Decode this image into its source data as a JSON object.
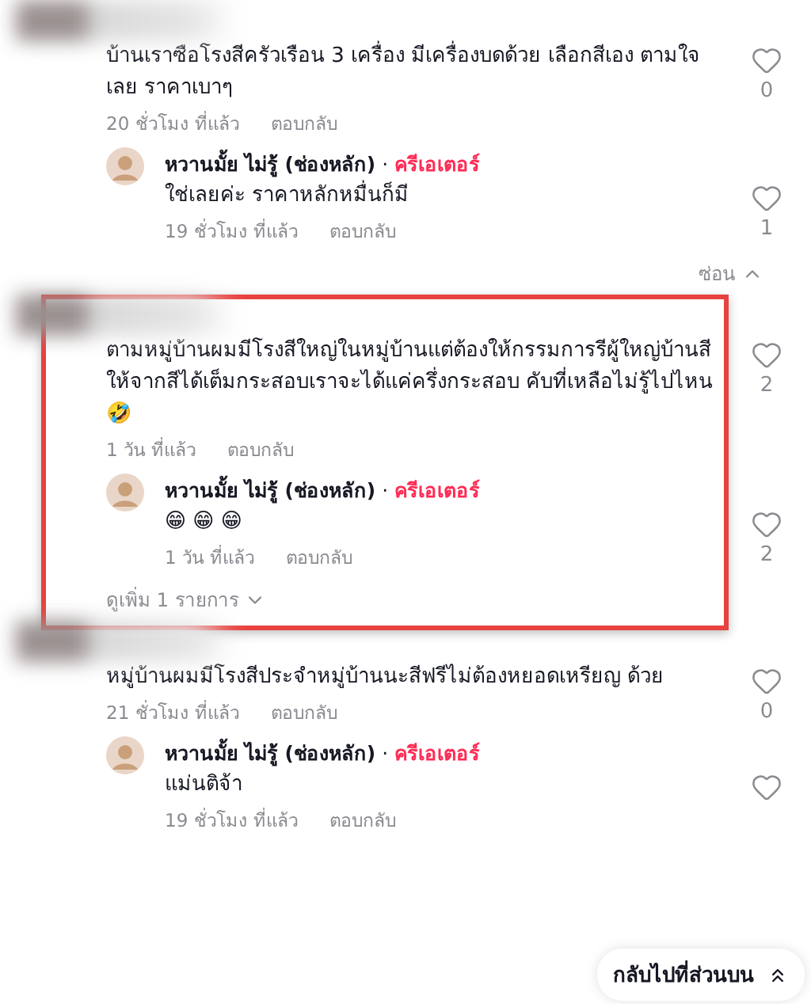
{
  "comments": [
    {
      "text": "บ้านเราซือโรงสีครัวเรือน 3 เครื่อง มีเครื่องบดด้วย เลือกสีเอง ตามใจเลย ราคาเบาๆ",
      "time": "20 ชั่วโมง ที่แล้ว",
      "reply_label": "ตอบกลับ",
      "likes": "0",
      "highlighted": false,
      "replies": [
        {
          "author": "หวานมั้ย ไม่รู้ (ช่องหลัก)",
          "separator": "·",
          "badge": "ครีเอเตอร์",
          "text": "ใช่เลยค่ะ ราคาหลักหมื่นก็มี",
          "time": "19 ชั่วโมง ที่แล้ว",
          "reply_label": "ตอบกลับ",
          "likes": "1"
        }
      ],
      "toggle": {
        "label": "ซ่อน",
        "expanded": true
      }
    },
    {
      "text": "ตามหมู่บ้านผมมีโรงสีใหญ่ในหมู่บ้านแต่ต้องให้กรรมการรีผู้ใหญ่บ้านสีให้จากสีได้เต็มกระสอบเราจะได้แค่ครึ่งกระสอบ คับที่เหลือไม่รู้ไปไหน 🤣",
      "time": "1 วัน ที่แล้ว",
      "reply_label": "ตอบกลับ",
      "likes": "2",
      "highlighted": true,
      "replies": [
        {
          "author": "หวานมั้ย ไม่รู้ (ช่องหลัก)",
          "separator": "·",
          "badge": "ครีเอเตอร์",
          "text": "😁 😁 😁",
          "time": "1 วัน ที่แล้ว",
          "reply_label": "ตอบกลับ",
          "likes": "2"
        }
      ],
      "toggle": {
        "label": "ดูเพิ่ม 1 รายการ",
        "expanded": false
      }
    },
    {
      "text": "หมู่บ้านผมมีโรงสีประจำหมู่บ้านนะสีฟรีไม่ต้องหยอดเหรียญ ด้วย",
      "time": "21 ชั่วโมง ที่แล้ว",
      "reply_label": "ตอบกลับ",
      "likes": "0",
      "highlighted": false,
      "replies": [
        {
          "author": "หวานมั้ย ไม่รู้ (ช่องหลัก)",
          "separator": "·",
          "badge": "ครีเอเตอร์",
          "text": "แม่นติจ้า",
          "time": "19 ชั่วโมง ที่แล้ว",
          "reply_label": "ตอบกลับ"
        }
      ]
    }
  ],
  "back_to_top": {
    "label": "กลับไปที่ส่วนบน"
  }
}
